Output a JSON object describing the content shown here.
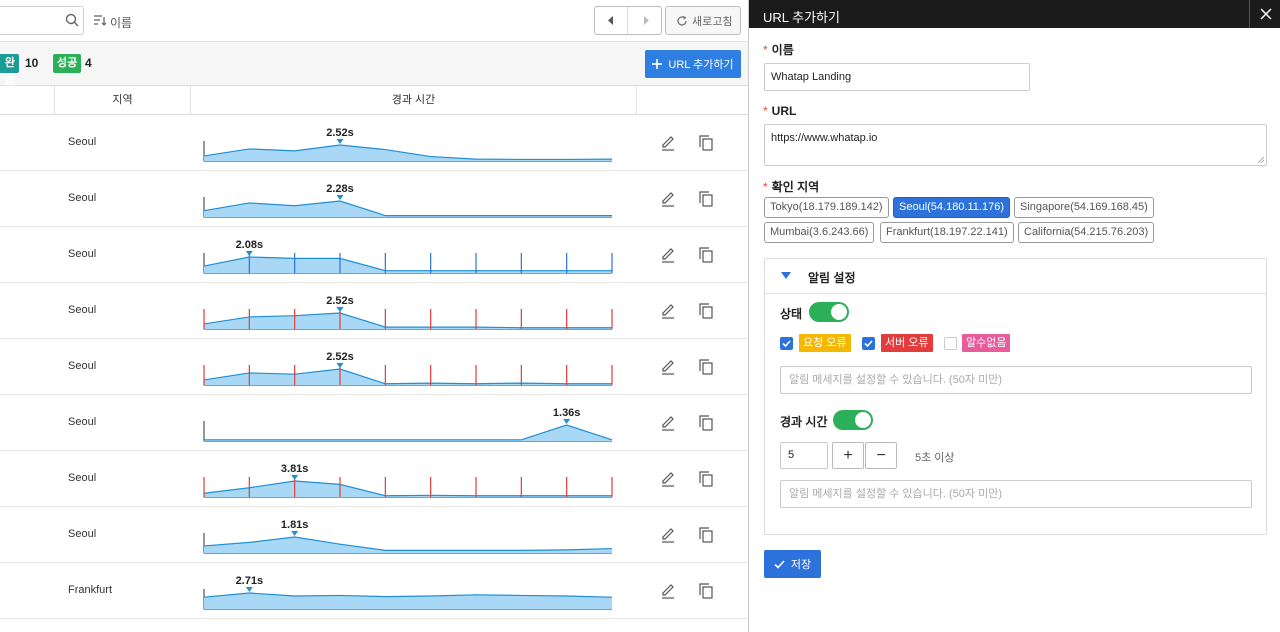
{
  "toolbar": {
    "sort_label": "이름",
    "refresh_label": "새로고침",
    "add_url_label": "URL 추가하기"
  },
  "status": {
    "done_label": "완료",
    "done_count": "10",
    "success_label": "성공",
    "success_count": "4"
  },
  "table": {
    "col_region": "지역",
    "col_elapsed": "경과 시간",
    "rows": [
      {
        "region": "Seoul",
        "peak_label": "2.52s",
        "peak_index": 3,
        "values": [
          0.8,
          1.9,
          1.6,
          2.52,
          1.8,
          0.7,
          0.3,
          0.25,
          0.25,
          0.3
        ],
        "errors": []
      },
      {
        "region": "Seoul",
        "peak_label": "2.28s",
        "peak_index": 3,
        "values": [
          0.9,
          2.0,
          1.6,
          2.28,
          0.2,
          0.2,
          0.2,
          0.2,
          0.2,
          0.2
        ],
        "errors": []
      },
      {
        "region": "Seoul",
        "peak_label": "2.08s",
        "peak_index": 1,
        "values": [
          0.9,
          2.08,
          1.9,
          1.9,
          0.3,
          0.3,
          0.3,
          0.3,
          0.3,
          0.3
        ],
        "errors": [
          1,
          2,
          3,
          4,
          5,
          6,
          7,
          8,
          9
        ],
        "error_color": "#2d72da"
      },
      {
        "region": "Seoul",
        "peak_label": "2.52s",
        "peak_index": 3,
        "values": [
          0.8,
          1.9,
          2.1,
          2.52,
          0.3,
          0.3,
          0.3,
          0.2,
          0.2,
          0.2
        ],
        "errors": [
          0,
          1,
          2,
          3,
          4,
          5,
          6,
          7,
          8,
          9
        ],
        "error_color": "#e23c3c"
      },
      {
        "region": "Seoul",
        "peak_label": "2.52s",
        "peak_index": 3,
        "values": [
          0.8,
          1.9,
          1.7,
          2.52,
          0.2,
          0.3,
          0.2,
          0.3,
          0.2,
          0.2
        ],
        "errors": [
          0,
          1,
          2,
          3,
          4,
          5,
          6,
          7,
          8,
          9
        ],
        "error_color": "#e23c3c"
      },
      {
        "region": "Seoul",
        "peak_label": "1.36s",
        "peak_index": 8,
        "values": [
          0.1,
          0.1,
          0.1,
          0.1,
          0.1,
          0.1,
          0.1,
          0.1,
          1.36,
          0.1
        ],
        "errors": []
      },
      {
        "region": "Seoul",
        "peak_label": "3.81s",
        "peak_index": 2,
        "values": [
          0.9,
          2.2,
          3.81,
          3.0,
          0.3,
          0.4,
          0.3,
          0.3,
          0.3,
          0.3
        ],
        "errors": [
          0,
          1,
          2,
          3,
          4,
          5,
          6,
          7,
          8,
          9
        ],
        "error_color": "#e23c3c"
      },
      {
        "region": "Seoul",
        "peak_label": "1.81s",
        "peak_index": 2,
        "values": [
          0.8,
          1.2,
          1.81,
          1.0,
          0.3,
          0.3,
          0.3,
          0.3,
          0.35,
          0.5
        ],
        "errors": []
      },
      {
        "region": "Frankfurt",
        "peak_label": "2.71s",
        "peak_index": 1,
        "values": [
          2.0,
          2.71,
          2.2,
          2.3,
          2.1,
          2.2,
          2.4,
          2.3,
          2.2,
          2.0
        ],
        "errors": []
      }
    ]
  },
  "drawer": {
    "title": "URL 추가하기",
    "name_label": "이름",
    "name_value": "Whatap Landing",
    "url_label": "URL",
    "url_value": "https://www.whatap.io",
    "regions_label": "확인 지역",
    "regions": [
      {
        "label": "Tokyo(18.179.189.142)",
        "selected": false
      },
      {
        "label": "Seoul(54.180.11.176)",
        "selected": true
      },
      {
        "label": "Singapore(54.169.168.45)",
        "selected": false
      },
      {
        "label": "Mumbai(3.6.243.66)",
        "selected": false
      },
      {
        "label": "Frankfurt(18.197.22.141)",
        "selected": false
      },
      {
        "label": "California(54.215.76.203)",
        "selected": false
      }
    ],
    "alarm": {
      "title": "알림 설정",
      "status_label": "상태",
      "status_on": true,
      "checks": [
        {
          "label": "요청 오류",
          "checked": true
        },
        {
          "label": "서버 오류",
          "checked": true
        },
        {
          "label": "알수없음",
          "checked": false
        }
      ],
      "msg_placeholder": "알림 메세지를 설정할 수 있습니다. (50자 미만)",
      "elapsed_label": "경과 시간",
      "elapsed_on": true,
      "elapsed_value": "5",
      "plus": "+",
      "minus": "−",
      "elapsed_hint": "5초 이상",
      "msg_placeholder2": "알림 메세지를 설정할 수 있습니다. (50자 미만)"
    },
    "save_label": "저장"
  },
  "colors": {
    "accent": "#2d72da",
    "success": "#2bb058",
    "done": "#1a9c97",
    "chart_fill": "#a8d8f5",
    "chart_line": "#1f8fd6",
    "error": "#e23c3c"
  }
}
